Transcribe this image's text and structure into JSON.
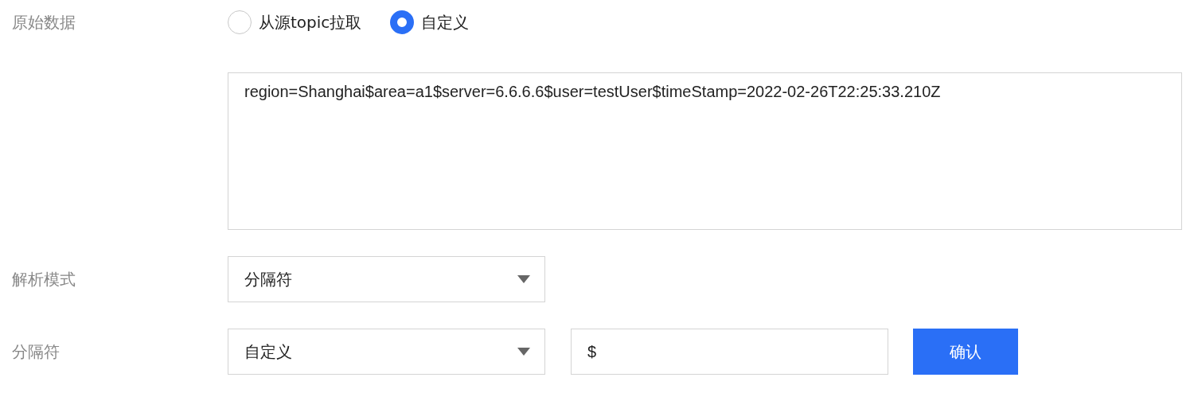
{
  "fields": [
    {
      "kind": "radio",
      "label": "原始数据",
      "options": [
        {
          "label": "从源topic拉取",
          "selected": false
        },
        {
          "label": "自定义",
          "selected": true
        }
      ]
    },
    {
      "kind": "textarea",
      "value": "region=Shanghai$area=a1$server=6.6.6.6$user=testUser$timeStamp=2022-02-26T22:25:33.210Z"
    },
    {
      "kind": "select",
      "label": "解析模式",
      "value": "分隔符"
    },
    {
      "kind": "select-input",
      "label": "分隔符",
      "value": "自定义",
      "input": "$",
      "button": "确认"
    }
  ]
}
